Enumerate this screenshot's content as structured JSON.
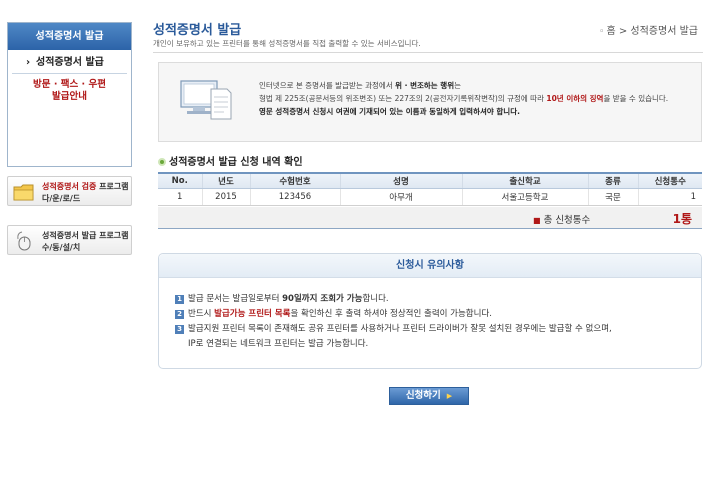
{
  "sidebar": {
    "header": "성적증명서 발급",
    "active_item": "성적증명서 발급",
    "sub_line1": "방문 · 팩스 · 우편",
    "sub_line2": "발급안내"
  },
  "promos": [
    {
      "title_red": "성적증명서 검증",
      "title_rest": " 프로그램",
      "subtitle": "다/운/로/드",
      "icon": "folder-icon"
    },
    {
      "title_red": "",
      "title_rest": "성적증명서 발급 프로그램",
      "subtitle": "수/동/설/치",
      "icon": "mouse-icon"
    }
  ],
  "header": {
    "title": "성적증명서 발급",
    "subtitle": "개인이 보유하고 있는 프린터를 통해 성적증명서를 직접 출력할 수 있는 서비스입니다.",
    "breadcrumb_home": "홈",
    "breadcrumb_sep": " > ",
    "breadcrumb_current": "성적증명서 발급"
  },
  "notice": {
    "line1_pre": "인터넷으로 본 증명서를 발급받는 과정에서 ",
    "line1_bold": "위 · 변조하는 행위",
    "line1_post": "는",
    "line2_pre": "형법 제 225조(공문서등의 위조변조) 또는 227조의 2(공전자기록위작변작)의 규정에 따라 ",
    "line2_red": "10년 이하의 징역",
    "line2_post": "을 받을 수 있습니다.",
    "line3": "영문 성적증명서 신청시 여권에 기재되어 있는 이름과 동일하게 입력하셔야 합니다."
  },
  "section": {
    "title": "성적증명서 발급 신청 내역 확인"
  },
  "table": {
    "headers": [
      "No.",
      "년도",
      "수험번호",
      "성명",
      "출신학교",
      "종류",
      "신청통수"
    ],
    "rows": [
      [
        "1",
        "2015",
        "123456",
        "아무개",
        "서울고등학교",
        "국문",
        "1"
      ]
    ]
  },
  "total": {
    "label": "총 신청통수",
    "value": "1통"
  },
  "caution": {
    "title": "신청시 유의사항",
    "items": [
      {
        "num": "1",
        "pre": "발급 문서는 발급일로부터 ",
        "hl": "90일까지 조회가 가능",
        "post": "합니다."
      },
      {
        "num": "2",
        "pre": "반드시 ",
        "hl": "발급가능 프린터 목록",
        "post": "을 확인하신 후 출력 하셔야 정상적인 출력이 가능합니다."
      },
      {
        "num": "3",
        "pre": "발급지원 프린터 목록이 존재해도 공유 프린터를 사용하거나 프린터 드라이버가 잘못 설치된 경우에는 발급할 수 없으며,",
        "hl": "",
        "post": ""
      }
    ],
    "item3_line2": "IP로 연결되는 네트워크 프린터는 발급 가능합니다."
  },
  "apply_button": {
    "label": "신청하기"
  }
}
